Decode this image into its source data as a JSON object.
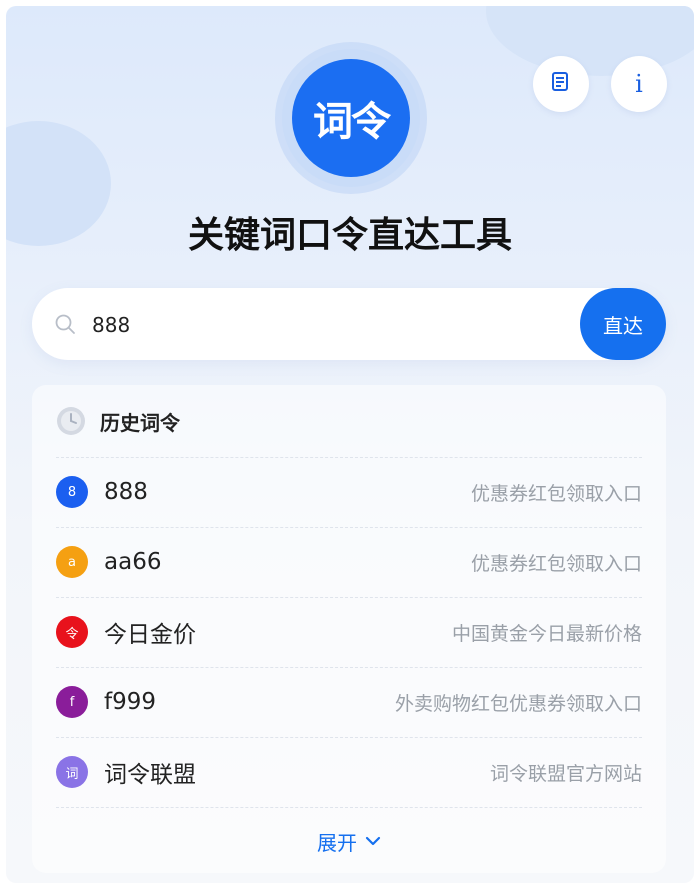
{
  "header": {
    "logo_text": "词令",
    "title": "关键词口令直达工具",
    "notes_icon": "notes-icon",
    "info_icon": "info-icon",
    "info_glyph": "i"
  },
  "search": {
    "value": "888",
    "placeholder": "",
    "button_label": "直达"
  },
  "history": {
    "title": "历史词令",
    "items": [
      {
        "badge": "8",
        "keyword": "888",
        "desc": "优惠券红包领取入口",
        "color": "#1b5ff0"
      },
      {
        "badge": "a",
        "keyword": "aa66",
        "desc": "优惠券红包领取入口",
        "color": "#f5a012"
      },
      {
        "badge": "令",
        "keyword": "今日金价",
        "desc": "中国黄金今日最新价格",
        "color": "#e8121c"
      },
      {
        "badge": "f",
        "keyword": "f999",
        "desc": "外卖购物红包优惠券领取入口",
        "color": "#8a1d9a"
      },
      {
        "badge": "词",
        "keyword": "词令联盟",
        "desc": "词令联盟官方网站",
        "color": "#8a73e6"
      }
    ],
    "expand_label": "展开"
  },
  "colors": {
    "accent": "#1570ef",
    "text": "#222222",
    "muted": "#9aa0a8"
  }
}
